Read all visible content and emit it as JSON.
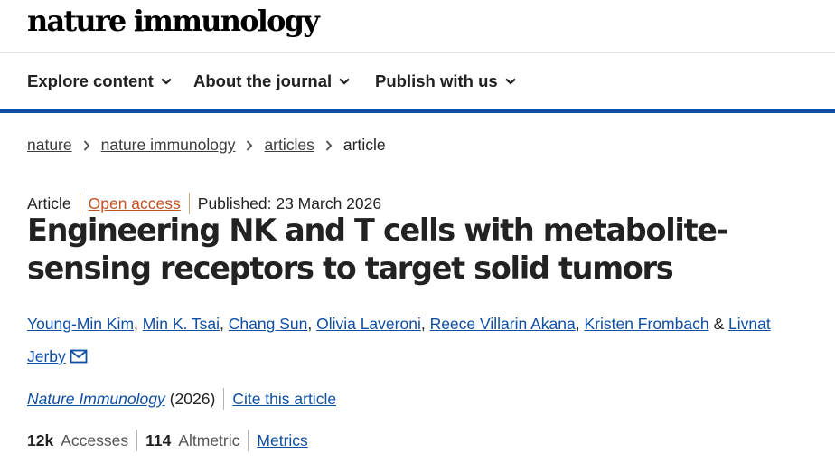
{
  "header": {
    "logo_text": "nature immunology"
  },
  "nav": {
    "items": [
      {
        "label": "Explore content",
        "icon": "chevron-down-icon"
      },
      {
        "label": "About the journal",
        "icon": "chevron-down-icon"
      },
      {
        "label": "Publish with us",
        "icon": "chevron-down-icon"
      }
    ]
  },
  "breadcrumb": {
    "items": [
      "nature",
      "nature immunology",
      "articles"
    ],
    "current": "article"
  },
  "article": {
    "type": "Article",
    "access": "Open access",
    "published": "Published: 23 March 2026",
    "title": "Engineering NK and T cells with metabolite-sensing receptors to target solid tumors",
    "authors": [
      "Young-Min Kim",
      "Min K. Tsai",
      "Chang Sun",
      "Olivia Laveroni",
      "Reece Villarin Akana",
      "Kristen Frombach"
    ],
    "author_separator": ", ",
    "last_author_joiner": " & ",
    "last_author_first": "Livnat",
    "last_author_rest": "Jerby",
    "journal": "Nature Immunology",
    "year": "(2026)",
    "cite_label": "Cite this article"
  },
  "metrics": {
    "accesses_value": "12k",
    "accesses_label": "Accesses",
    "altmetric_value": "114",
    "altmetric_label": "Altmetric",
    "metrics_link": "Metrics"
  },
  "colors": {
    "link": "#0f4fa3",
    "open_access": "#c35224",
    "nav_border": "#0f4fa3"
  }
}
